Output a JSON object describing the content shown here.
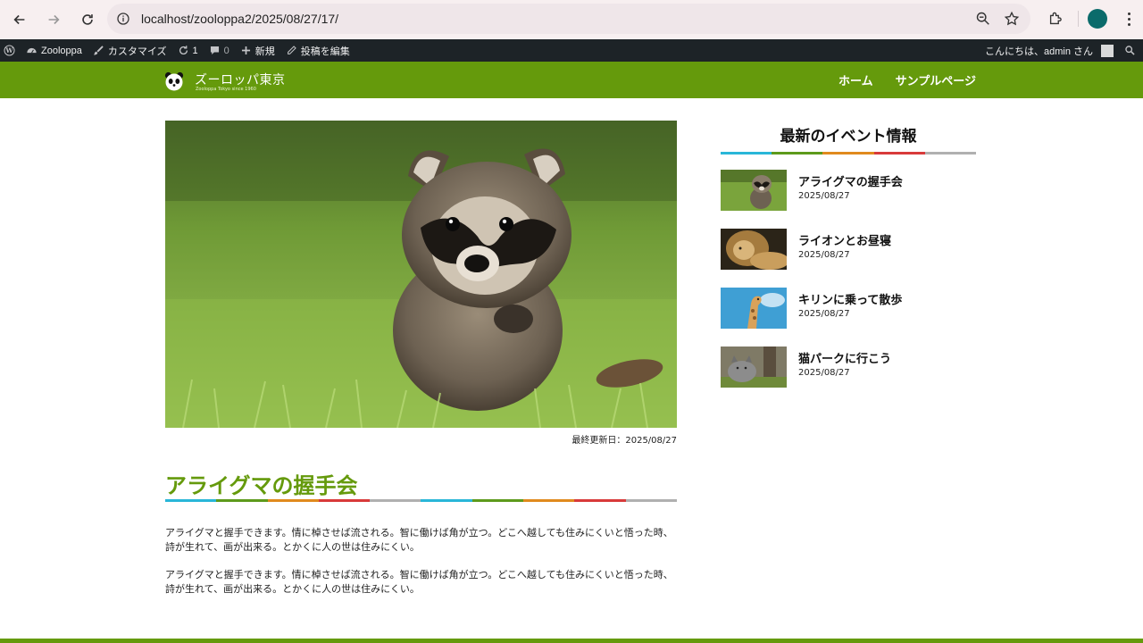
{
  "browser": {
    "url": "localhost/zooloppa2/2025/08/27/17/",
    "profile_color": "#0b6b6b"
  },
  "adminbar": {
    "site_name": "Zooloppa",
    "customize": "カスタマイズ",
    "updates_count": "1",
    "comments_count": "0",
    "new_label": "新規",
    "edit_post": "投稿を編集",
    "greeting": "こんにちは、admin さん"
  },
  "header": {
    "site_title": "ズーロッパ東京",
    "tagline": "Zooloppa Tokyo since 1960",
    "nav": [
      "ホーム",
      "サンプルページ"
    ],
    "brand_color": "#659a0c"
  },
  "post": {
    "updated": "最終更新日：2025/08/27",
    "title": "アライグマの握手会",
    "paragraphs": [
      "アライグマと握手できます。情に棹させば流される。智に働けば角が立つ。どこへ越しても住みにくいと悟った時、詩が生れて、画が出来る。とかくに人の世は住みにくい。",
      "アライグマと握手できます。情に棹させば流される。智に働けば角が立つ。どこへ越しても住みにくいと悟った時、詩が生れて、画が出来る。とかくに人の世は住みにくい。"
    ]
  },
  "stripe_colors": [
    "#29b6d8",
    "#5d9a1c",
    "#e08a1e",
    "#d83a3a",
    "#b0b0b0"
  ],
  "sidebar": {
    "title": "最新のイベント情報",
    "items": [
      {
        "name": "アライグマの握手会",
        "date": "2025/08/27"
      },
      {
        "name": "ライオンとお昼寝",
        "date": "2025/08/27"
      },
      {
        "name": "キリンに乗って散歩",
        "date": "2025/08/27"
      },
      {
        "name": "猫パークに行こう",
        "date": "2025/08/27"
      }
    ]
  }
}
